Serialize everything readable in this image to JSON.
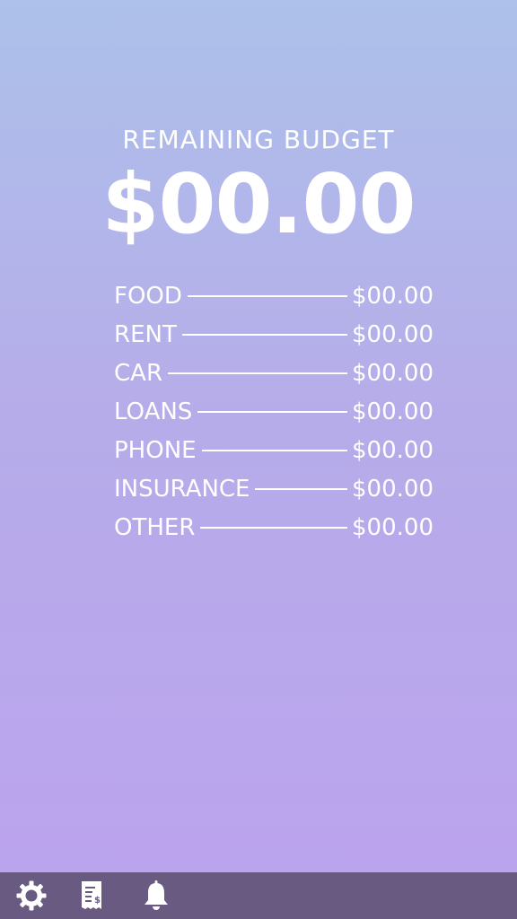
{
  "header": {
    "title": "REMAINING BUDGET",
    "amount": "$00.00"
  },
  "categories": [
    {
      "label": "FOOD",
      "value": "$00.00"
    },
    {
      "label": "RENT",
      "value": "$00.00"
    },
    {
      "label": "CAR",
      "value": "$00.00"
    },
    {
      "label": "LOANS",
      "value": "$00.00"
    },
    {
      "label": "PHONE",
      "value": "$00.00"
    },
    {
      "label": "INSURANCE",
      "value": "$00.00"
    },
    {
      "label": "OTHER",
      "value": "$00.00"
    }
  ],
  "bottom_bar": {
    "icons": [
      "gear-icon",
      "receipt-icon",
      "bell-icon"
    ]
  },
  "colors": {
    "gradient_top": "#adc1ea",
    "gradient_bottom": "#bca3ee",
    "bar": "#685a80",
    "text": "#ffffff"
  }
}
